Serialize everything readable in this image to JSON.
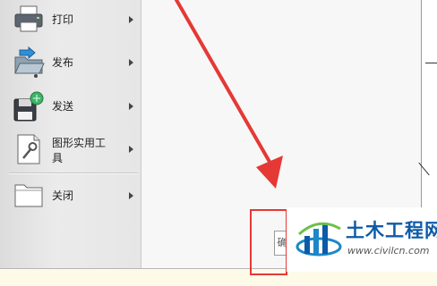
{
  "menu": {
    "items": [
      {
        "id": "print",
        "label": "打印",
        "icon": "printer-icon"
      },
      {
        "id": "publish",
        "label": "发布",
        "icon": "publish-icon"
      },
      {
        "id": "send",
        "label": "发送",
        "icon": "send-icon"
      },
      {
        "id": "drawing-utilities",
        "label_line1": "图形实用工",
        "label_line2": "具",
        "icon": "utilities-icon"
      },
      {
        "id": "close",
        "label": "关闭",
        "icon": "close-folder-icon"
      }
    ]
  },
  "dialog": {
    "button_partial": "确"
  },
  "annotation": {
    "arrow_color": "#e53935",
    "box_color": "#e53935"
  },
  "watermark": {
    "title": "土木工程网",
    "url": "www.civilcn.com",
    "brand_color": "#0d5aa7"
  }
}
